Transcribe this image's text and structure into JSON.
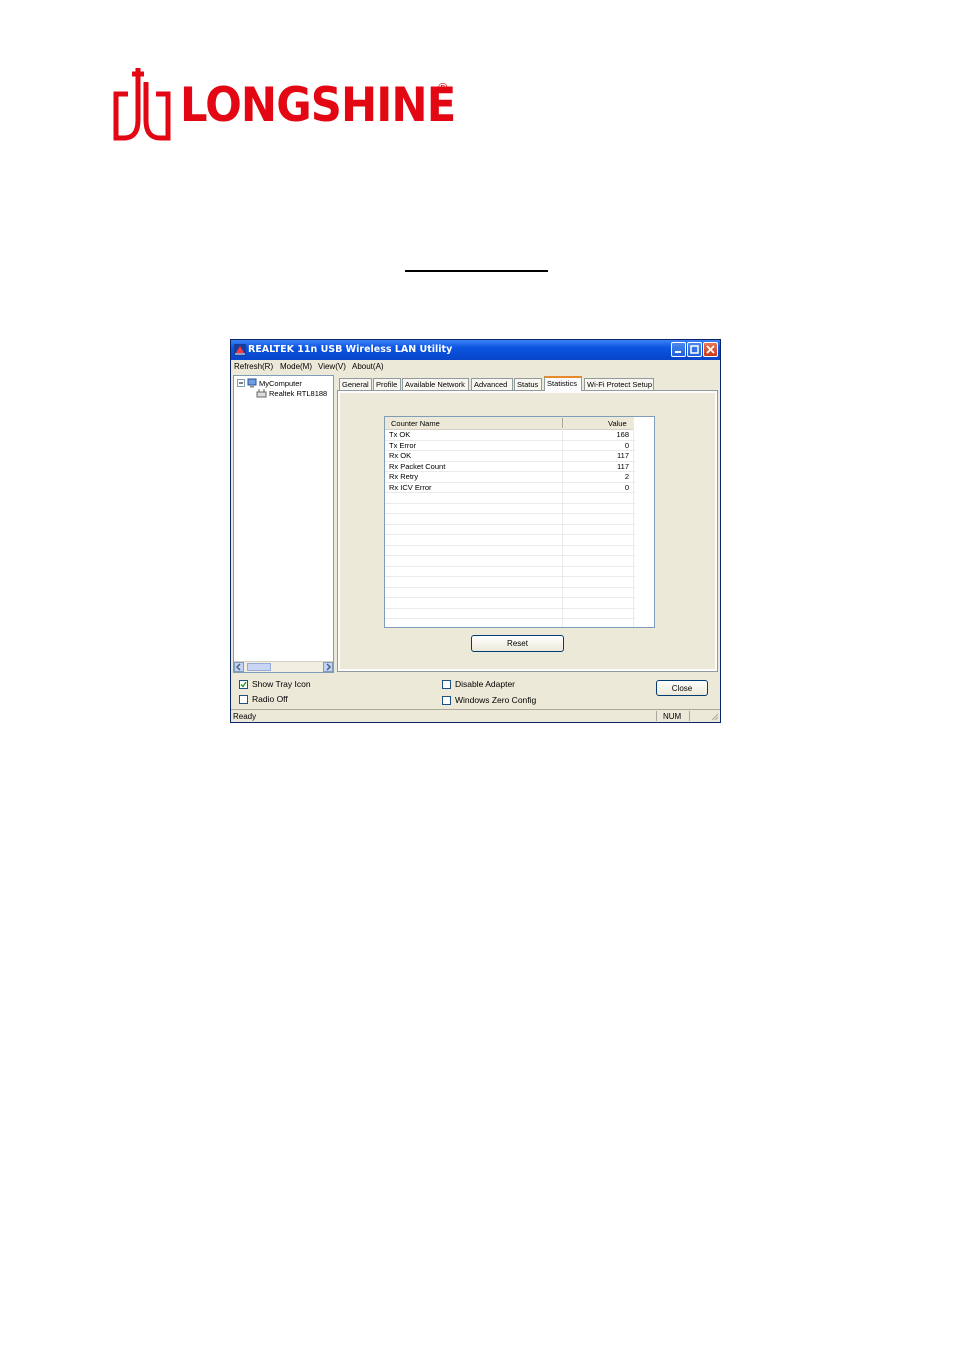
{
  "brand": {
    "name": "LONGSHINE",
    "registered_mark": "®",
    "color": "#e30613"
  },
  "window": {
    "title": "REALTEK 11n USB Wireless LAN Utility",
    "icon": "network-signal-icon",
    "controls": [
      "minimize",
      "maximize",
      "close"
    ]
  },
  "menu": [
    {
      "label": "Refresh(R)"
    },
    {
      "label": "Mode(M)"
    },
    {
      "label": "View(V)"
    },
    {
      "label": "About(A)"
    }
  ],
  "tree": {
    "root": "MyComputer",
    "child": "Realtek RTL8188"
  },
  "tabs": [
    {
      "label": "General"
    },
    {
      "label": "Profile"
    },
    {
      "label": "Available Network"
    },
    {
      "label": "Advanced"
    },
    {
      "label": "Status"
    },
    {
      "label": "Statistics",
      "active": true
    },
    {
      "label": "Wi-Fi Protect Setup"
    }
  ],
  "statistics": {
    "columns": {
      "name": "Counter Name",
      "value": "Value"
    },
    "rows": [
      {
        "name": "Tx OK",
        "value": "168"
      },
      {
        "name": "Tx Error",
        "value": "0"
      },
      {
        "name": "Rx OK",
        "value": "117"
      },
      {
        "name": "Rx Packet Count",
        "value": "117"
      },
      {
        "name": "Rx Retry",
        "value": "2"
      },
      {
        "name": "Rx ICV Error",
        "value": "0"
      }
    ],
    "reset_label": "Reset"
  },
  "options": {
    "show_tray_icon": {
      "label": "Show Tray Icon",
      "checked": true
    },
    "radio_off": {
      "label": "Radio Off",
      "checked": false
    },
    "disable_adapter": {
      "label": "Disable Adapter",
      "checked": false
    },
    "windows_zero_config": {
      "label": "Windows Zero Config",
      "checked": false
    }
  },
  "close_label": "Close",
  "status": {
    "text": "Ready",
    "num": "NUM"
  },
  "colors": {
    "titlebar": "#0a54e0",
    "active_tab_accent": "#e68b2c",
    "window_bg": "#ece9d8"
  }
}
